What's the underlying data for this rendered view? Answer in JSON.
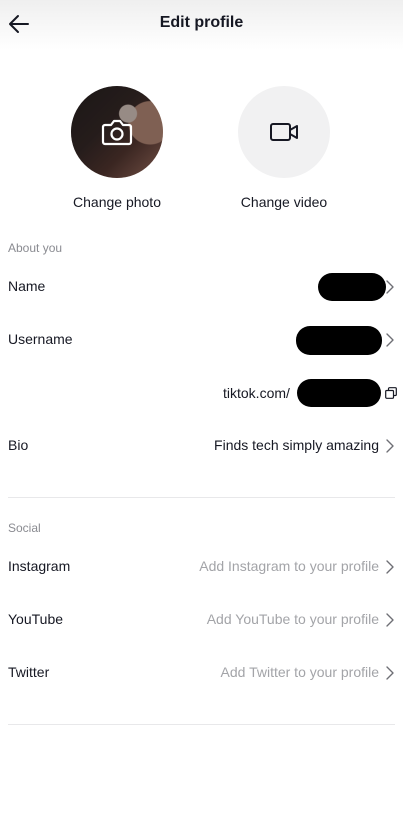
{
  "header": {
    "title": "Edit profile",
    "back_icon": "arrow-left-icon"
  },
  "media": {
    "photo": {
      "label": "Change photo",
      "icon": "camera-icon"
    },
    "video": {
      "label": "Change video",
      "icon": "video-camera-icon"
    }
  },
  "about": {
    "section_label": "About you",
    "name": {
      "label": "Name"
    },
    "username": {
      "label": "Username"
    },
    "link": {
      "prefix": "tiktok.com/",
      "icon": "copy-icon"
    },
    "bio": {
      "label": "Bio",
      "value": "Finds tech simply amazing"
    }
  },
  "social": {
    "section_label": "Social",
    "instagram": {
      "label": "Instagram",
      "value": "Add Instagram to your profile"
    },
    "youtube": {
      "label": "YouTube",
      "value": "Add YouTube to your profile"
    },
    "twitter": {
      "label": "Twitter",
      "value": "Add Twitter to your profile"
    }
  },
  "colors": {
    "text_primary": "#161823",
    "text_secondary": "#8a8b91",
    "text_placeholder": "#a3a4a8",
    "divider": "#e8e8ea",
    "video_circle_bg": "#f1f1f2"
  }
}
